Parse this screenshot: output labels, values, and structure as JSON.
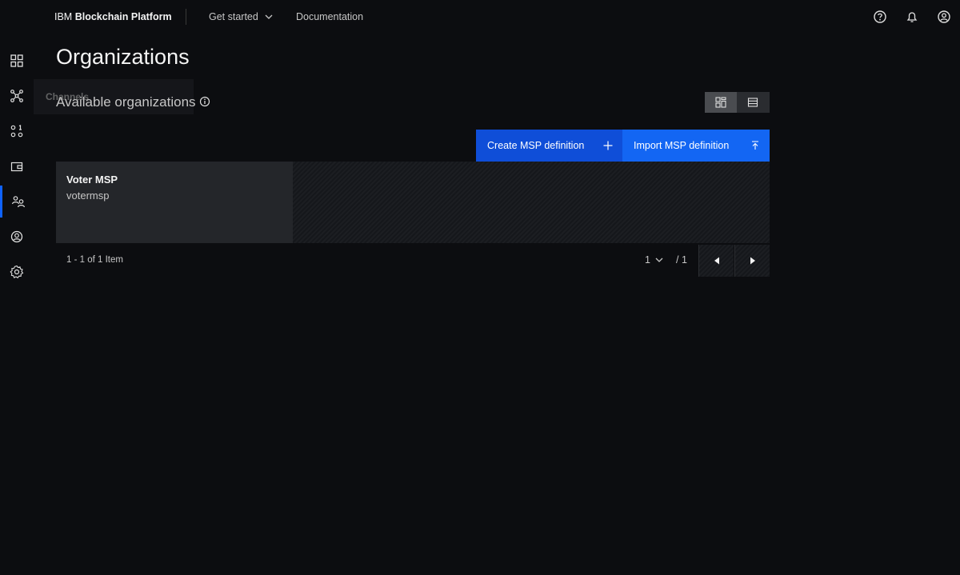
{
  "header": {
    "brand_prefix": "IBM",
    "brand_name": "Blockchain Platform",
    "nav": {
      "get_started": "Get started",
      "documentation": "Documentation"
    },
    "icons": [
      "help-icon",
      "notification-icon",
      "user-profile-icon"
    ]
  },
  "sidenav": {
    "items": [
      "dashboard-icon",
      "channels-icon",
      "smart-contracts-icon",
      "wallet-icon",
      "organizations-icon",
      "users-icon",
      "settings-icon"
    ],
    "active": "organizations-icon",
    "tooltip": "Channels"
  },
  "page": {
    "title": "Organizations",
    "section_title": "Available organizations"
  },
  "actions": {
    "create": "Create MSP definition",
    "import": "Import MSP definition"
  },
  "organizations": [
    {
      "name": "Voter MSP",
      "msp_id": "votermsp"
    }
  ],
  "pagination": {
    "items_text": "1 - 1 of 1 Item",
    "current_page": "1",
    "total_pages": "/ 1"
  },
  "colors": {
    "accent": "#0f62fe",
    "create_button": "#0f4ed8",
    "import_button": "#1366f3",
    "background": "#0c0d10"
  }
}
